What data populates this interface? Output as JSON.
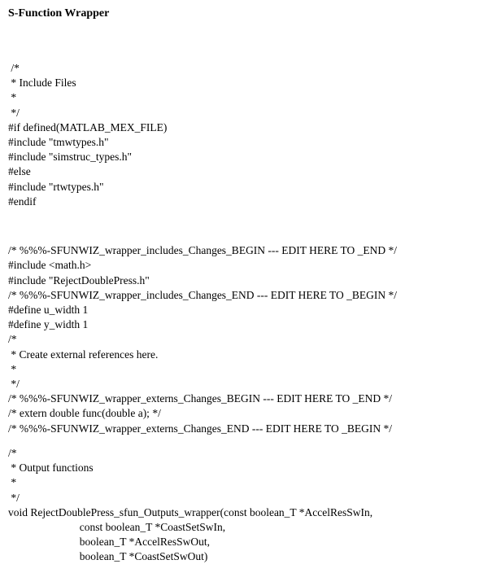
{
  "title": "S-Function Wrapper",
  "block1": " /*\n * Include Files\n *\n */\n#if defined(MATLAB_MEX_FILE)\n#include \"tmwtypes.h\"\n#include \"simstruc_types.h\"\n#else\n#include \"rtwtypes.h\"\n#endif",
  "block2": "/* %%%-SFUNWIZ_wrapper_includes_Changes_BEGIN --- EDIT HERE TO _END */\n#include <math.h>\n#include \"RejectDoublePress.h\"\n/* %%%-SFUNWIZ_wrapper_includes_Changes_END --- EDIT HERE TO _BEGIN */\n#define u_width 1\n#define y_width 1\n/*\n * Create external references here.\n *\n */\n/* %%%-SFUNWIZ_wrapper_externs_Changes_BEGIN --- EDIT HERE TO _END */\n/* extern double func(double a); */\n/* %%%-SFUNWIZ_wrapper_externs_Changes_END --- EDIT HERE TO _BEGIN */",
  "block3": "/*\n * Output functions\n *\n */\nvoid RejectDoublePress_sfun_Outputs_wrapper(const boolean_T *AccelResSwIn,\n                          const boolean_T *CoastSetSwIn,\n                          boolean_T *AccelResSwOut,\n                          boolean_T *CoastSetSwOut)"
}
